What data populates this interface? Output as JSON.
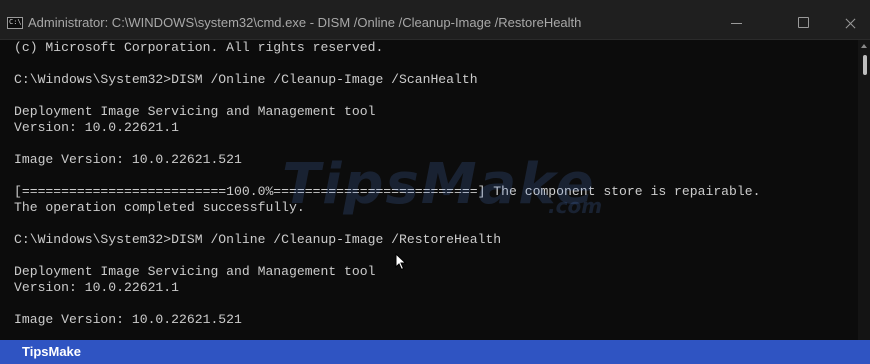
{
  "window": {
    "title": "Administrator: C:\\WINDOWS\\system32\\cmd.exe - DISM  /Online /Cleanup-Image /RestoreHealth",
    "icon_text": "C:\\",
    "controls": [
      "minimize-icon",
      "maximize-icon",
      "close-icon"
    ]
  },
  "console": {
    "lines": [
      "(c) Microsoft Corporation. All rights reserved.",
      "",
      "C:\\Windows\\System32>DISM /Online /Cleanup-Image /ScanHealth",
      "",
      "Deployment Image Servicing and Management tool",
      "Version: 10.0.22621.1",
      "",
      "Image Version: 10.0.22621.521",
      "",
      "[==========================100.0%==========================] The component store is repairable.",
      "The operation completed successfully.",
      "",
      "C:\\Windows\\System32>DISM /Online /Cleanup-Image /RestoreHealth",
      "",
      "Deployment Image Servicing and Management tool",
      "Version: 10.0.22621.1",
      "",
      "Image Version: 10.0.22621.521"
    ]
  },
  "watermark": {
    "text": "TipsMake",
    "suffix": ".com"
  },
  "brand_bar": {
    "label": "TipsMake",
    "color": "#2f54c2"
  },
  "colors": {
    "console_bg": "#0c0c0c",
    "console_text": "#cccccc",
    "titlebar_bg": "#1f1f1f"
  }
}
